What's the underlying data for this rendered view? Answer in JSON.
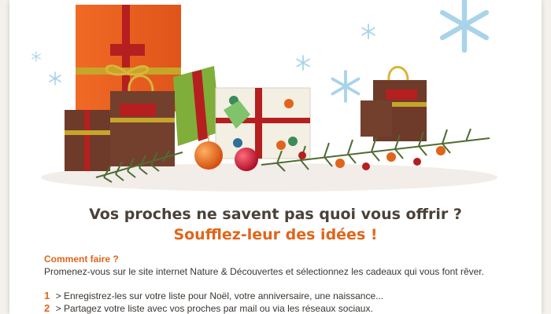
{
  "hero": {
    "brand_label": "Nature & Découvertes"
  },
  "headline": "Vos proches ne savent pas quoi vous offrir ?",
  "subheadline": "Soufflez-leur des idées !",
  "how": {
    "title": "Comment faire ?",
    "description": "Promenez-vous sur le site internet Nature & Découvertes et sélectionnez les cadeaux qui vous font rêver."
  },
  "steps": [
    {
      "number": "1",
      "separator": ">",
      "text": "Enregistrez-les sur votre liste pour Noël, votre anniversaire, une naissance..."
    },
    {
      "number": "2",
      "separator": ">",
      "text": "Partagez votre liste avec vos proches par mail ou via les réseaux sociaux."
    }
  ],
  "colors": {
    "accent": "#e0651c",
    "text": "#3b3530",
    "headline": "#4a4138",
    "snowflake": "#a9d3ea"
  }
}
